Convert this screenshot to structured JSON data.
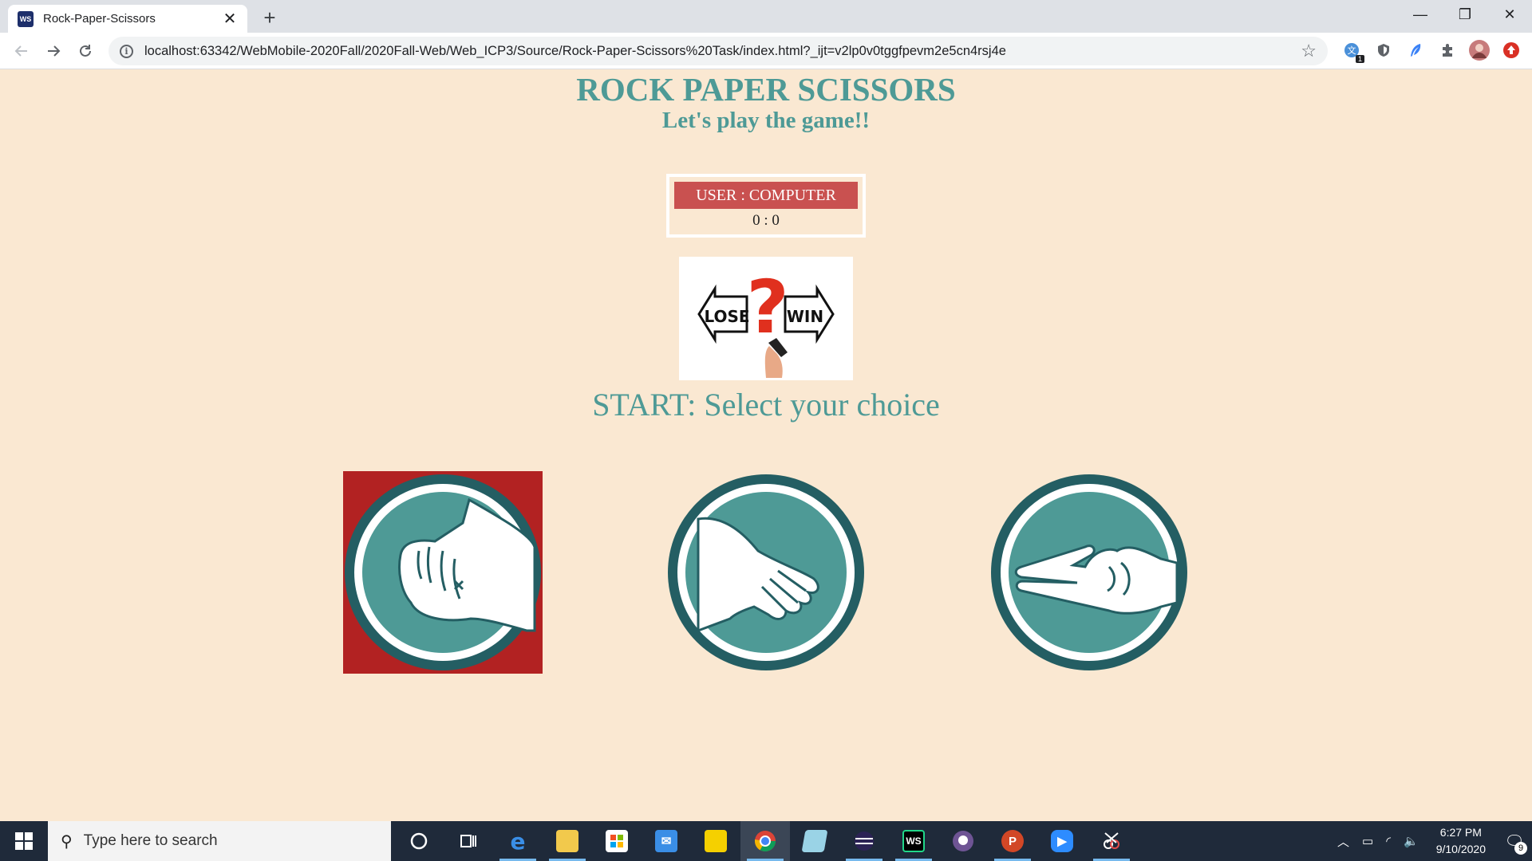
{
  "browser": {
    "tab": {
      "title": "Rock-Paper-Scissors",
      "favicon": "webstorm-icon",
      "close": "✕"
    },
    "new_tab": "+",
    "window_controls": {
      "minimize": "—",
      "restore": "❐",
      "close": "✕"
    },
    "url": "localhost:63342/WebMobile-2020Fall/2020Fall-Web/Web_ICP3/Source/Rock-Paper-Scissors%20Task/index.html?_ijt=v2lp0v0tggfpevm2e5cn4rsj4e",
    "extensions": [
      "translate-icon",
      "shield-icon",
      "feather-icon",
      "puzzle-icon",
      "profile-avatar",
      "update-icon"
    ],
    "extension_badge": "1"
  },
  "page": {
    "title": "ROCK PAPER SCISSORS",
    "subtitle": "Let's play the game!!",
    "scoreboard": {
      "label": "USER : COMPUTER",
      "score": "0 : 0"
    },
    "result_image": {
      "left_word": "LOSE",
      "right_word": "WIN",
      "mark": "?"
    },
    "start_text": "START: Select your choice",
    "choices": [
      {
        "name": "rock",
        "selected": true
      },
      {
        "name": "paper",
        "selected": false
      },
      {
        "name": "scissors",
        "selected": false
      }
    ],
    "colors": {
      "background": "#fae8d2",
      "teal": "#4e9a96",
      "dark_teal": "#245e63",
      "score_red": "#c95150",
      "selected_red": "#b22222"
    }
  },
  "taskbar": {
    "search_placeholder": "Type here to search",
    "apps": [
      "cortana-icon",
      "task-view-icon",
      "edge-icon",
      "file-explorer-icon",
      "store-icon",
      "mail-icon",
      "sticky-notes-icon",
      "chrome-icon",
      "notepad-icon",
      "eclipse-icon",
      "webstorm-icon",
      "github-icon",
      "powerpoint-icon",
      "zoom-icon",
      "snipping-tool-icon"
    ],
    "time": "6:27 PM",
    "date": "9/10/2020",
    "notification_count": "9"
  }
}
